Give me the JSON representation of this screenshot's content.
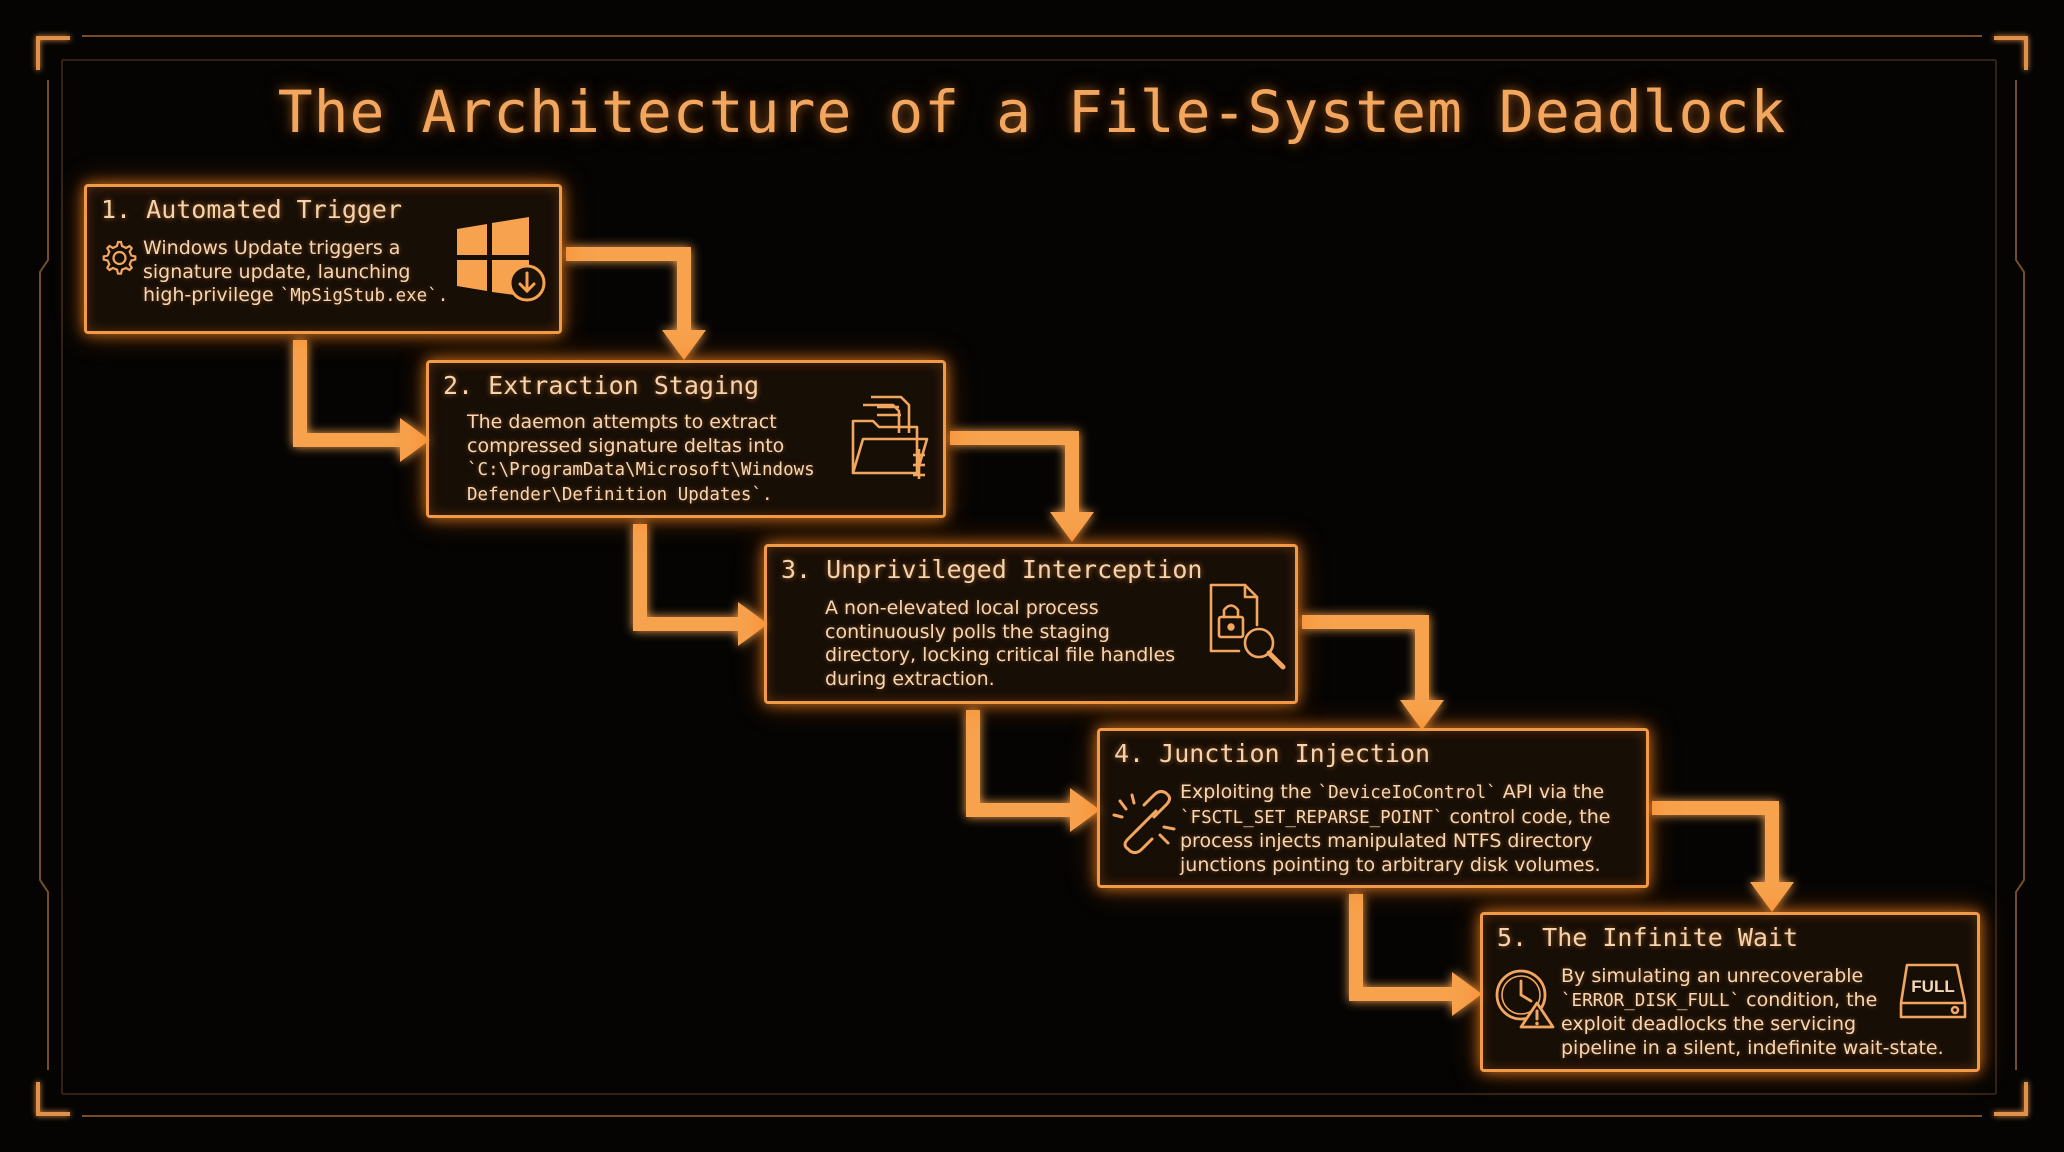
{
  "title": "The Architecture of a File-System Deadlock",
  "theme": {
    "accent": "#f29a45",
    "text": "#f5d7b6",
    "background": "#050403"
  },
  "steps": [
    {
      "title": "1. Automated Trigger",
      "icons": [
        "gear-icon",
        "windows-update-icon"
      ],
      "lines": [
        [
          {
            "t": "Windows Update triggers a"
          }
        ],
        [
          {
            "t": "signature update, launching"
          }
        ],
        [
          {
            "t": "high-privilege "
          },
          {
            "t": "`MpSigStub.exe`.",
            "mono": true
          }
        ]
      ]
    },
    {
      "title": "2. Extraction Staging",
      "icons": [
        "folder-documents-icon"
      ],
      "lines": [
        [
          {
            "t": "The daemon attempts to extract"
          }
        ],
        [
          {
            "t": "compressed signature deltas into"
          }
        ],
        [
          {
            "t": "`C:\\ProgramData\\Microsoft\\Windows",
            "mono": true
          }
        ],
        [
          {
            "t": "Defender\\Definition Updates`.",
            "mono": true
          }
        ]
      ]
    },
    {
      "title": "3. Unprivileged Interception",
      "icons": [
        "locked-file-search-icon"
      ],
      "lines": [
        [
          {
            "t": "A non-elevated local process"
          }
        ],
        [
          {
            "t": "continuously polls the staging"
          }
        ],
        [
          {
            "t": "directory, locking critical file handles"
          }
        ],
        [
          {
            "t": "during extraction."
          }
        ]
      ]
    },
    {
      "title": "4. Junction Injection",
      "icons": [
        "broken-link-icon"
      ],
      "lines": [
        [
          {
            "t": "Exploiting the "
          },
          {
            "t": "`DeviceIoControl`",
            "mono": true
          },
          {
            "t": " API via the"
          }
        ],
        [
          {
            "t": "`FSCTL_SET_REPARSE_POINT`",
            "mono": true
          },
          {
            "t": " control code, the"
          }
        ],
        [
          {
            "t": "process injects manipulated NTFS directory"
          }
        ],
        [
          {
            "t": "junctions pointing to arbitrary disk volumes."
          }
        ]
      ]
    },
    {
      "title": "5. The Infinite Wait",
      "icons": [
        "clock-warning-icon",
        "disk-full-icon"
      ],
      "disk_label": "FULL",
      "lines": [
        [
          {
            "t": "By simulating an unrecoverable"
          }
        ],
        [
          {
            "t": "`ERROR_DISK_FULL`",
            "mono": true
          },
          {
            "t": " condition, the"
          }
        ],
        [
          {
            "t": "exploit deadlocks the servicing"
          }
        ],
        [
          {
            "t": "pipeline in a silent, indefinite wait-state."
          }
        ]
      ]
    }
  ]
}
